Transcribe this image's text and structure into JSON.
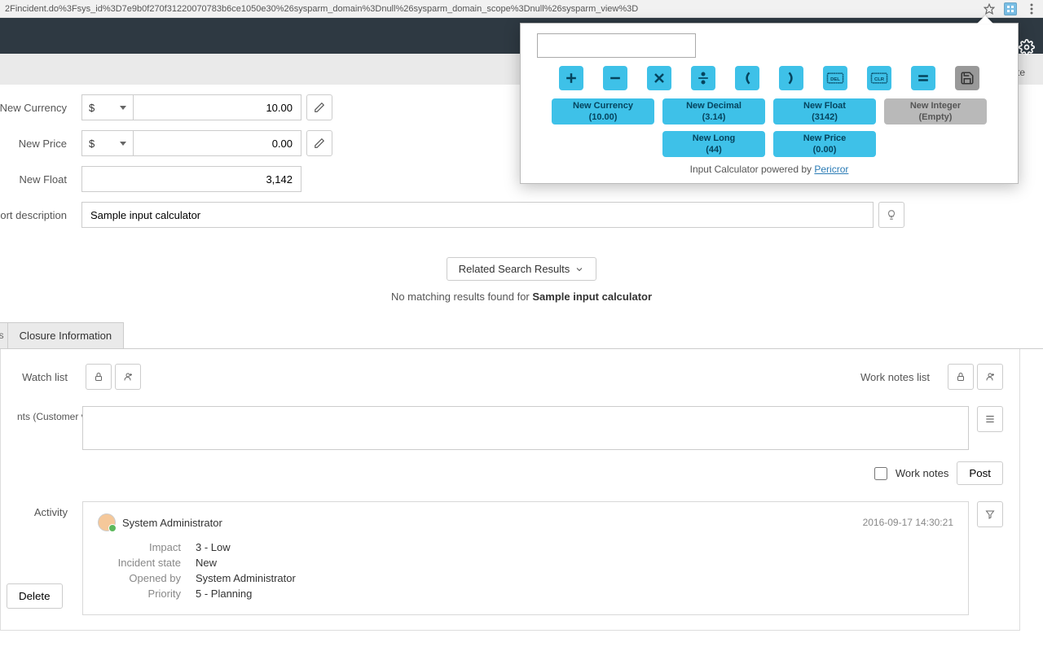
{
  "browser": {
    "url": "2Fincident.do%3Fsys_id%3D7e9b0f270f31220070783b6ce1050e30%26sysparm_domain%3Dnull%26sysparm_domain_scope%3Dnull%26sysparm_view%3D"
  },
  "form": {
    "new_currency": {
      "label": "New Currency",
      "symbol": "$",
      "value": "10.00"
    },
    "new_price": {
      "label": "New Price",
      "symbol": "$",
      "value": "0.00"
    },
    "new_float": {
      "label": "New Float",
      "value": "3,142"
    },
    "short_desc": {
      "label": "Short description",
      "value": "Sample input calculator"
    }
  },
  "related_search": {
    "btn_label": "Related Search Results",
    "no_match_prefix": "No matching results found for ",
    "no_match_term": "Sample input calculator"
  },
  "tabs": {
    "cut_label": "ls",
    "closure": "Closure Information"
  },
  "watch": {
    "watch_list": "Watch list",
    "work_notes_list": "Work notes list"
  },
  "comments": {
    "label": "nts (Customer visible)",
    "work_notes": "Work notes",
    "post": "Post"
  },
  "activity": {
    "label": "Activity",
    "user": "System Administrator",
    "timestamp": "2016-09-17 14:30:21",
    "fields": {
      "impact": {
        "label": "Impact",
        "value": "3 - Low"
      },
      "incident_state": {
        "label": "Incident state",
        "value": "New"
      },
      "opened_by": {
        "label": "Opened by",
        "value": "System Administrator"
      },
      "priority": {
        "label": "Priority",
        "value": "5 - Planning"
      }
    }
  },
  "delete_btn": "Delete",
  "calc": {
    "fields": {
      "new_currency": {
        "label": "New Currency",
        "hint": "(10.00)"
      },
      "new_decimal": {
        "label": "New Decimal",
        "hint": "(3.14)"
      },
      "new_float": {
        "label": "New Float",
        "hint": "(3142)"
      },
      "new_integer": {
        "label": "New Integer",
        "hint": "(Empty)"
      },
      "new_long": {
        "label": "New Long",
        "hint": "(44)"
      },
      "new_price": {
        "label": "New Price",
        "hint": "(0.00)"
      }
    },
    "footer_text": "Input Calculator powered by ",
    "footer_link": "Pericror"
  },
  "partial_delete": "ete"
}
